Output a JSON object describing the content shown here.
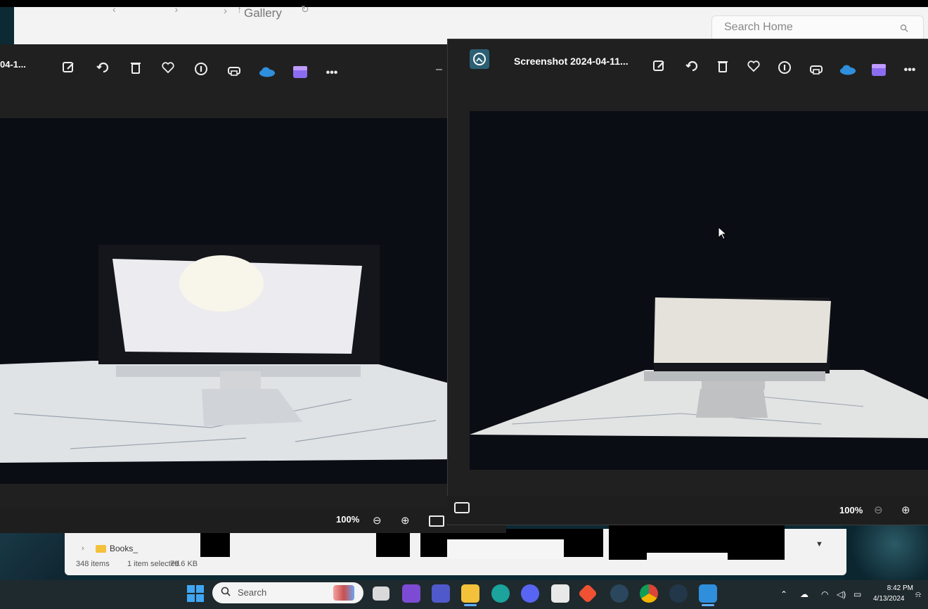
{
  "explorer": {
    "breadcrumb": "Gallery",
    "search_placeholder": "Search Home",
    "sidebar_item": "Books_",
    "status": {
      "items": "348 items",
      "selected": "1 item selected",
      "size": "79.6 KB"
    }
  },
  "photos_left": {
    "title": "04-1...",
    "zoom": "100%",
    "toolbar": [
      "edit-icon",
      "rotate-icon",
      "delete-icon",
      "favorite-icon",
      "info-icon",
      "print-icon",
      "onedrive-icon",
      "clipchamp-icon",
      "more-icon"
    ]
  },
  "photos_right": {
    "title": "Screenshot 2024-04-11...",
    "zoom": "100%",
    "toolbar": [
      "edit-icon",
      "rotate-icon",
      "delete-icon",
      "favorite-icon",
      "info-icon",
      "print-icon",
      "onedrive-icon",
      "clipchamp-icon",
      "more-icon"
    ]
  },
  "taskbar": {
    "search_placeholder": "Search",
    "time": "8:42 PM",
    "date": "4/13/2024",
    "apps": [
      "task-view",
      "visual-studio",
      "teams",
      "file-explorer",
      "edge",
      "discord",
      "store",
      "git",
      "steam",
      "chrome",
      "steam-vr",
      "photos"
    ]
  },
  "colors": {
    "window_bg": "#202020",
    "canvas_bg": "#0b0d14",
    "taskbar_bg": "#1f2a2e",
    "onedrive": "#2f8fdc",
    "clipchamp": "#8b6cf0"
  }
}
